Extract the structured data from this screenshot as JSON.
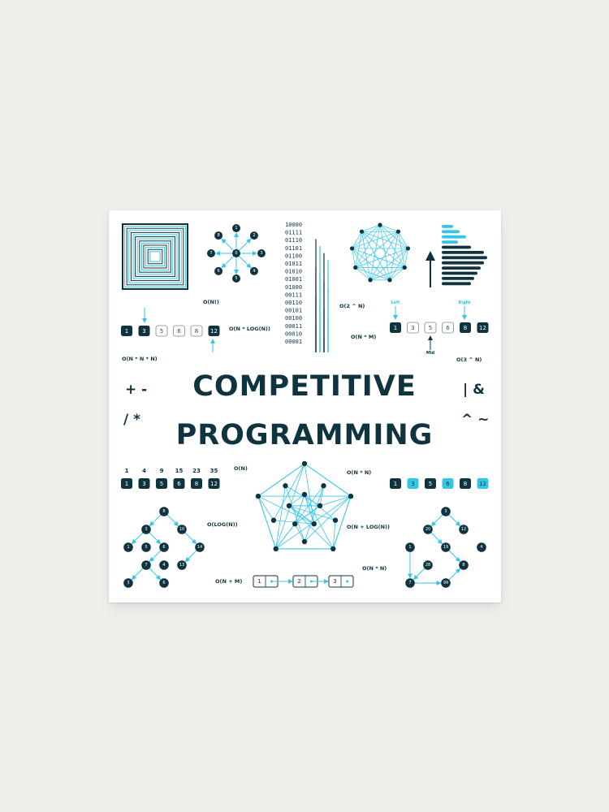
{
  "title_line1": "COMPETITIVE",
  "title_line2": "PROGRAMMING",
  "symbols": {
    "top_left": "+ -",
    "bottom_left": "/ *",
    "top_right": "| &",
    "bottom_right": "^ ~"
  },
  "complexities": {
    "factorial": "O(N!)",
    "n_log_n": "O(N * LOG(N))",
    "exp": "O(2 ^ N)",
    "n_times_m": "O(N * M)",
    "cubic": "O(N * N * N)",
    "three_pow_n": "O(3 ^ N)",
    "linear": "O(N)",
    "quadratic": "O(N * N)",
    "log": "O(LOG(N))",
    "n_plus_log": "O(N + LOG(N))",
    "n_plus_m": "O(N + M)",
    "n_times_n_br": "O(N * N)"
  },
  "binary_search": {
    "values": [
      "1",
      "3",
      "5",
      "6",
      "8",
      "12"
    ],
    "left_label": "Left",
    "right_label": "Right",
    "mid_label": "Mid"
  },
  "sorted_array_top": [
    "1",
    "3",
    "5",
    "6",
    "8",
    "12"
  ],
  "prefix": {
    "sums": [
      "1",
      "4",
      "9",
      "15",
      "23",
      "35"
    ],
    "values": [
      "1",
      "3",
      "5",
      "6",
      "8",
      "12"
    ]
  },
  "highlight_array": [
    "1",
    "3",
    "5",
    "6",
    "8",
    "12"
  ],
  "bst_left": [
    "8",
    "3",
    "10",
    "1",
    "6",
    "14",
    "4",
    "7",
    "13",
    "5",
    "3",
    "6"
  ],
  "tree_right": [
    "3",
    "20",
    "12",
    "19",
    "4",
    "1",
    "8",
    "28",
    "99",
    "7"
  ],
  "star_nodes": [
    "1",
    "2",
    "3",
    "4",
    "5",
    "6",
    "7",
    "8",
    "9"
  ],
  "linked_list": [
    "1",
    "2",
    "3"
  ],
  "binary_strings": [
    "10000",
    "01111",
    "01110",
    "01101",
    "01100",
    "01011",
    "01010",
    "01001",
    "01000",
    "00111",
    "00110",
    "00101",
    "00100",
    "00011",
    "00010",
    "00001"
  ],
  "colors": {
    "dark": "#0f3440",
    "cyan": "#35c6e6"
  }
}
